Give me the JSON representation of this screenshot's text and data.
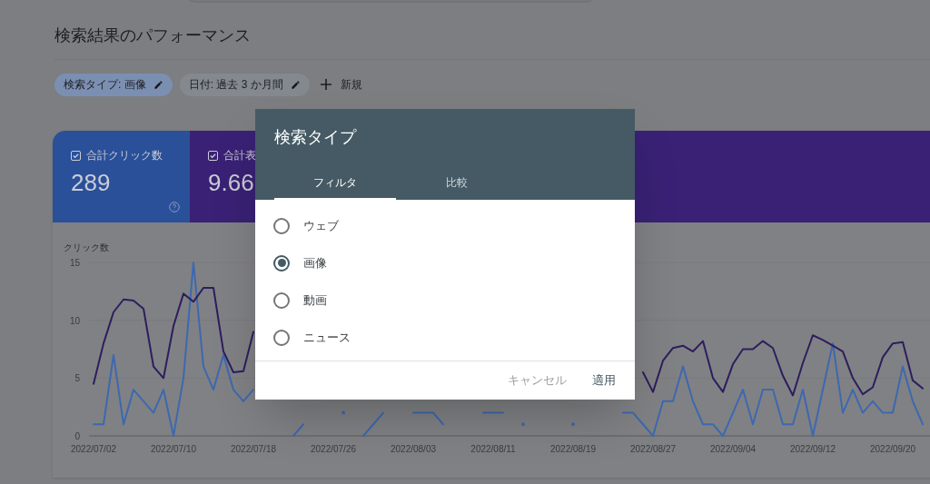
{
  "page_title": "検索結果のパフォーマンス",
  "filters": [
    {
      "label": "検索タイプ: 画像",
      "active": true
    },
    {
      "label": "日付: 過去 3 か月間",
      "active": false
    }
  ],
  "new_filter": {
    "label": "新規"
  },
  "metrics": [
    {
      "label": "合計クリック数",
      "value": "289",
      "checked": true,
      "color": "#2b509a",
      "help": true
    },
    {
      "label": "合計表",
      "value": "9.66",
      "checked": true,
      "color": "#3a2175",
      "help": false
    }
  ],
  "chart": {
    "chart_data": {
      "type": "line",
      "ylabel": "クリック数",
      "ylim": [
        0,
        15
      ],
      "yticks": [
        0,
        5,
        10,
        15
      ],
      "categories": [
        "2022/07/02",
        null,
        null,
        null,
        null,
        null,
        null,
        null,
        "2022/07/10",
        null,
        null,
        null,
        null,
        null,
        null,
        null,
        "2022/07/18",
        null,
        null,
        null,
        null,
        null,
        null,
        null,
        "2022/07/26",
        null,
        null,
        null,
        null,
        null,
        null,
        null,
        "2022/08/03",
        null,
        null,
        null,
        null,
        null,
        null,
        null,
        "2022/08/11",
        null,
        null,
        null,
        null,
        null,
        null,
        null,
        "2022/08/19",
        null,
        null,
        null,
        null,
        null,
        null,
        null,
        "2022/08/27",
        null,
        null,
        null,
        null,
        null,
        null,
        null,
        "2022/09/04",
        null,
        null,
        null,
        null,
        null,
        null,
        null,
        "2022/09/12",
        null,
        null,
        null,
        null,
        null,
        null,
        null,
        "2022/09/20",
        null,
        null,
        null
      ],
      "series": [
        {
          "color": "#3d68b0",
          "values": [
            1,
            1,
            7,
            1,
            4,
            3,
            2,
            4,
            0,
            5,
            15,
            6,
            4,
            7,
            4,
            3,
            4,
            null,
            null,
            null,
            0,
            1,
            null,
            null,
            null,
            2,
            null,
            0,
            1,
            2,
            null,
            null,
            2,
            2,
            2,
            1,
            null,
            null,
            null,
            2,
            2,
            2,
            null,
            1,
            null,
            null,
            null,
            null,
            1,
            null,
            null,
            null,
            null,
            2,
            2,
            1,
            0,
            3,
            3,
            6,
            3,
            1,
            1,
            0,
            2,
            4,
            1,
            4,
            4,
            1,
            1,
            4,
            0,
            4,
            8,
            2,
            4,
            2,
            3,
            2,
            2,
            6,
            3,
            1
          ]
        },
        {
          "color": "#2e1d5e",
          "values": [
            4.5,
            8,
            10.7,
            11.8,
            11.7,
            11,
            6,
            5,
            9.5,
            12.3,
            11.6,
            12.8,
            12.8,
            7.3,
            5.5,
            5.6,
            9,
            null,
            null,
            null,
            null,
            null,
            null,
            null,
            null,
            null,
            null,
            null,
            null,
            null,
            null,
            null,
            null,
            null,
            null,
            null,
            null,
            null,
            null,
            null,
            null,
            null,
            null,
            null,
            null,
            null,
            null,
            null,
            null,
            null,
            null,
            null,
            null,
            null,
            null,
            5.5,
            3.8,
            6.5,
            7.6,
            7.8,
            7.3,
            8.2,
            5,
            3.8,
            6.2,
            7.5,
            7.5,
            8.2,
            7.6,
            5.2,
            3.5,
            6.3,
            8.7,
            8.3,
            7.8,
            7.3,
            5,
            3.6,
            4.2,
            6.8,
            8,
            8.1,
            4.8,
            4.1
          ]
        }
      ]
    }
  },
  "dialog": {
    "title": "検索タイプ",
    "tabs": [
      {
        "label": "フィルタ",
        "selected": true
      },
      {
        "label": "比較",
        "selected": false
      }
    ],
    "options": [
      {
        "label": "ウェブ",
        "selected": false
      },
      {
        "label": "画像",
        "selected": true
      },
      {
        "label": "動画",
        "selected": false
      },
      {
        "label": "ニュース",
        "selected": false
      }
    ],
    "buttons": [
      {
        "label": "キャンセル",
        "kind": "secondary"
      },
      {
        "label": "適用",
        "kind": "primary"
      }
    ]
  }
}
